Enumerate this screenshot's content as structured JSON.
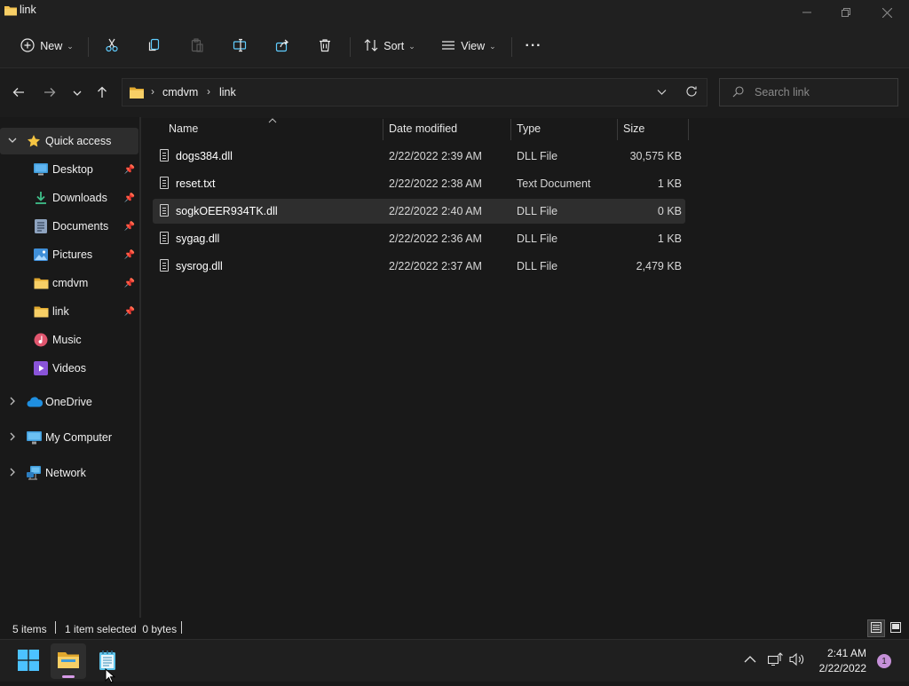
{
  "window": {
    "title": "link",
    "controls": [
      "minimize",
      "maximize",
      "close"
    ]
  },
  "toolbar": {
    "new_label": "New",
    "sort_label": "Sort",
    "view_label": "View",
    "more_label": "···"
  },
  "address": {
    "breadcrumb": [
      "cmdvm",
      "link"
    ],
    "search_placeholder": "Search link"
  },
  "nav_pane": {
    "quick_access_label": "Quick access",
    "pinned": [
      {
        "label": "Desktop",
        "icon": "desktop-icon"
      },
      {
        "label": "Downloads",
        "icon": "downloads-icon"
      },
      {
        "label": "Documents",
        "icon": "documents-icon"
      },
      {
        "label": "Pictures",
        "icon": "pictures-icon"
      },
      {
        "label": "cmdvm",
        "icon": "folder-icon"
      },
      {
        "label": "link",
        "icon": "folder-icon"
      }
    ],
    "unpinned": [
      {
        "label": "Music",
        "icon": "music-icon"
      },
      {
        "label": "Videos",
        "icon": "videos-icon"
      }
    ],
    "roots": [
      {
        "label": "OneDrive",
        "icon": "onedrive-icon"
      },
      {
        "label": "My Computer",
        "icon": "computer-icon"
      },
      {
        "label": "Network",
        "icon": "network-icon"
      }
    ]
  },
  "columns": {
    "name": "Name",
    "date": "Date modified",
    "type": "Type",
    "size": "Size"
  },
  "files": [
    {
      "name": "dogs384.dll",
      "date": "2/22/2022 2:39 AM",
      "type": "DLL File",
      "size": "30,575 KB",
      "selected": false
    },
    {
      "name": "reset.txt",
      "date": "2/22/2022 2:38 AM",
      "type": "Text Document",
      "size": "1 KB",
      "selected": false
    },
    {
      "name": "sogkOEER934TK.dll",
      "date": "2/22/2022 2:40 AM",
      "type": "DLL File",
      "size": "0 KB",
      "selected": true
    },
    {
      "name": "sygag.dll",
      "date": "2/22/2022 2:36 AM",
      "type": "DLL File",
      "size": "1 KB",
      "selected": false
    },
    {
      "name": "sysrog.dll",
      "date": "2/22/2022 2:37 AM",
      "type": "DLL File",
      "size": "2,479 KB",
      "selected": false
    }
  ],
  "status": {
    "count": "5 items",
    "selection": "1 item selected  0 bytes"
  },
  "taskbar": {
    "time": "2:41 AM",
    "date": "2/22/2022",
    "notification_count": "1"
  },
  "colors": {
    "background": "#191919",
    "chrome": "#202020",
    "selected_row": "#2e2e2e",
    "folder": "#f2c14e",
    "accent": "#60cdff"
  }
}
